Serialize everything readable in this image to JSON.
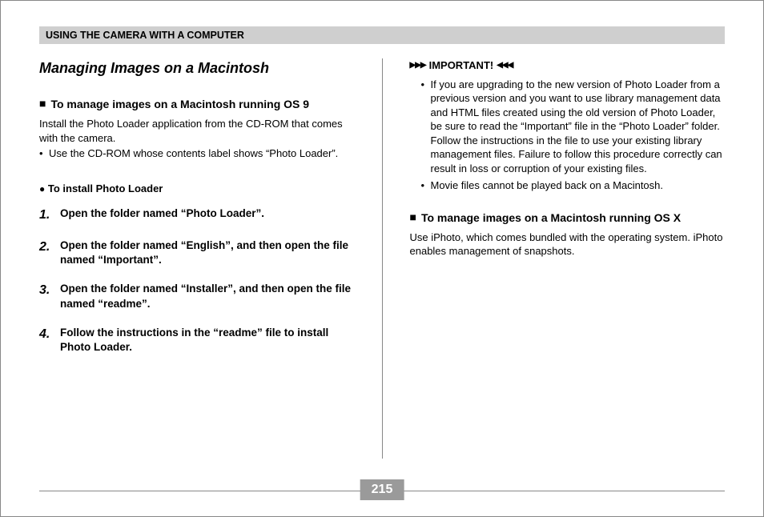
{
  "header": "USING THE CAMERA WITH A COMPUTER",
  "left": {
    "title": "Managing Images on a Macintosh",
    "sub1": "To manage images on a Macintosh running OS 9",
    "body1": "Install the Photo Loader application from the CD-ROM that comes with the camera.",
    "bullet1": "Use the CD-ROM whose contents label shows “Photo Loader”.",
    "mini": "To install Photo Loader",
    "steps": [
      "Open the folder named “Photo Loader”.",
      "Open the folder named “English”, and then open the file named “Important”.",
      "Open the folder named “Installer”, and then open the file named “readme”.",
      "Follow the instructions in the “readme” file to install Photo Loader."
    ]
  },
  "right": {
    "important_label": "IMPORTANT!",
    "imp1": "If you are upgrading to the new version of Photo Loader from a previous version and you want to use library management data and HTML files created using the old version of Photo Loader, be sure to read the “Important” file in the “Photo Loader” folder. Follow the instructions in the file to use your existing library management files. Failure to follow this procedure correctly can result in loss or corruption of your existing files.",
    "imp2": "Movie files cannot be played back on a Macintosh.",
    "sub2": "To manage images on a Macintosh running OS X",
    "body2": "Use iPhoto, which comes bundled with the operating system. iPhoto enables management of snapshots."
  },
  "page_number": "215"
}
